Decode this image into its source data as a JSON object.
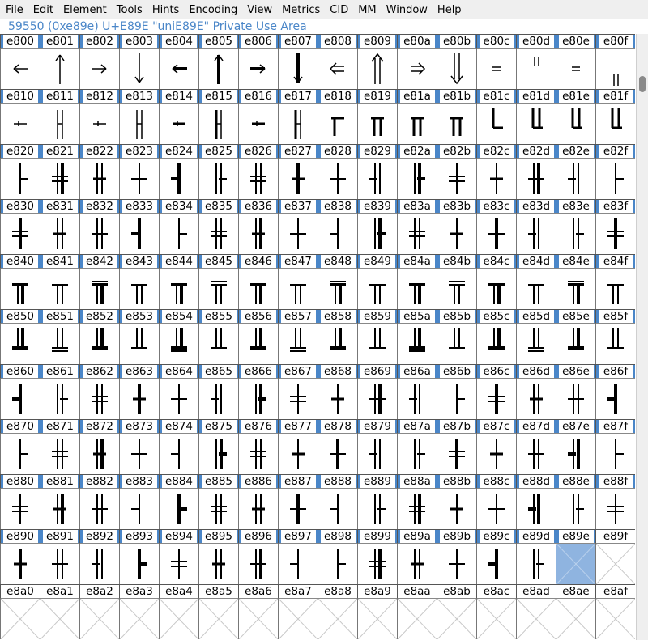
{
  "menubar": {
    "items": [
      {
        "label": "File",
        "name": "menu-file"
      },
      {
        "label": "Edit",
        "name": "menu-edit"
      },
      {
        "label": "Element",
        "name": "menu-element"
      },
      {
        "label": "Tools",
        "name": "menu-tools"
      },
      {
        "label": "Hints",
        "name": "menu-hints"
      },
      {
        "label": "Encoding",
        "name": "menu-encoding"
      },
      {
        "label": "View",
        "name": "menu-view"
      },
      {
        "label": "Metrics",
        "name": "menu-metrics"
      },
      {
        "label": "CID",
        "name": "menu-cid"
      },
      {
        "label": "MM",
        "name": "menu-mm"
      },
      {
        "label": "Window",
        "name": "menu-window"
      },
      {
        "label": "Help",
        "name": "menu-help"
      }
    ]
  },
  "info": {
    "text": "59550 (0xe89e) U+E89E \"uniE89E\" Private Use Area"
  },
  "grid": {
    "columns": 16,
    "start_codepoint": "e800",
    "last_defined": "e89e",
    "selected": "e89e",
    "rows": [
      [
        "e800",
        "e801",
        "e802",
        "e803",
        "e804",
        "e805",
        "e806",
        "e807",
        "e808",
        "e809",
        "e80a",
        "e80b",
        "e80c",
        "e80d",
        "e80e",
        "e80f"
      ],
      [
        "e810",
        "e811",
        "e812",
        "e813",
        "e814",
        "e815",
        "e816",
        "e817",
        "e818",
        "e819",
        "e81a",
        "e81b",
        "e81c",
        "e81d",
        "e81e",
        "e81f"
      ],
      [
        "e820",
        "e821",
        "e822",
        "e823",
        "e824",
        "e825",
        "e826",
        "e827",
        "e828",
        "e829",
        "e82a",
        "e82b",
        "e82c",
        "e82d",
        "e82e",
        "e82f"
      ],
      [
        "e830",
        "e831",
        "e832",
        "e833",
        "e834",
        "e835",
        "e836",
        "e837",
        "e838",
        "e839",
        "e83a",
        "e83b",
        "e83c",
        "e83d",
        "e83e",
        "e83f"
      ],
      [
        "e840",
        "e841",
        "e842",
        "e843",
        "e844",
        "e845",
        "e846",
        "e847",
        "e848",
        "e849",
        "e84a",
        "e84b",
        "e84c",
        "e84d",
        "e84e",
        "e84f"
      ],
      [
        "e850",
        "e851",
        "e852",
        "e853",
        "e854",
        "e855",
        "e856",
        "e857",
        "e858",
        "e859",
        "e85a",
        "e85b",
        "e85c",
        "e85d",
        "e85e",
        "e85f"
      ],
      [
        "e860",
        "e861",
        "e862",
        "e863",
        "e864",
        "e865",
        "e866",
        "e867",
        "e868",
        "e869",
        "e86a",
        "e86b",
        "e86c",
        "e86d",
        "e86e",
        "e86f"
      ],
      [
        "e870",
        "e871",
        "e872",
        "e873",
        "e874",
        "e875",
        "e876",
        "e877",
        "e878",
        "e879",
        "e87a",
        "e87b",
        "e87c",
        "e87d",
        "e87e",
        "e87f"
      ],
      [
        "e880",
        "e881",
        "e882",
        "e883",
        "e884",
        "e885",
        "e886",
        "e887",
        "e888",
        "e889",
        "e88a",
        "e88b",
        "e88c",
        "e88d",
        "e88e",
        "e88f"
      ],
      [
        "e890",
        "e891",
        "e892",
        "e893",
        "e894",
        "e895",
        "e896",
        "e897",
        "e898",
        "e899",
        "e89a",
        "e89b",
        "e89c",
        "e89d",
        "e89e",
        "e89f"
      ],
      [
        "e8a0",
        "e8a1",
        "e8a2",
        "e8a3",
        "e8a4",
        "e8a5",
        "e8a6",
        "e8a7",
        "e8a8",
        "e8a9",
        "e8aa",
        "e8ab",
        "e8ac",
        "e8ad",
        "e8ae",
        "e8af"
      ]
    ]
  },
  "colors": {
    "accent": "#4a86c8",
    "selected_cell": "#8fb4e0",
    "menubar_bg": "#efefef",
    "glyph": "#000000",
    "empty_cross": "#c8c8c8"
  }
}
